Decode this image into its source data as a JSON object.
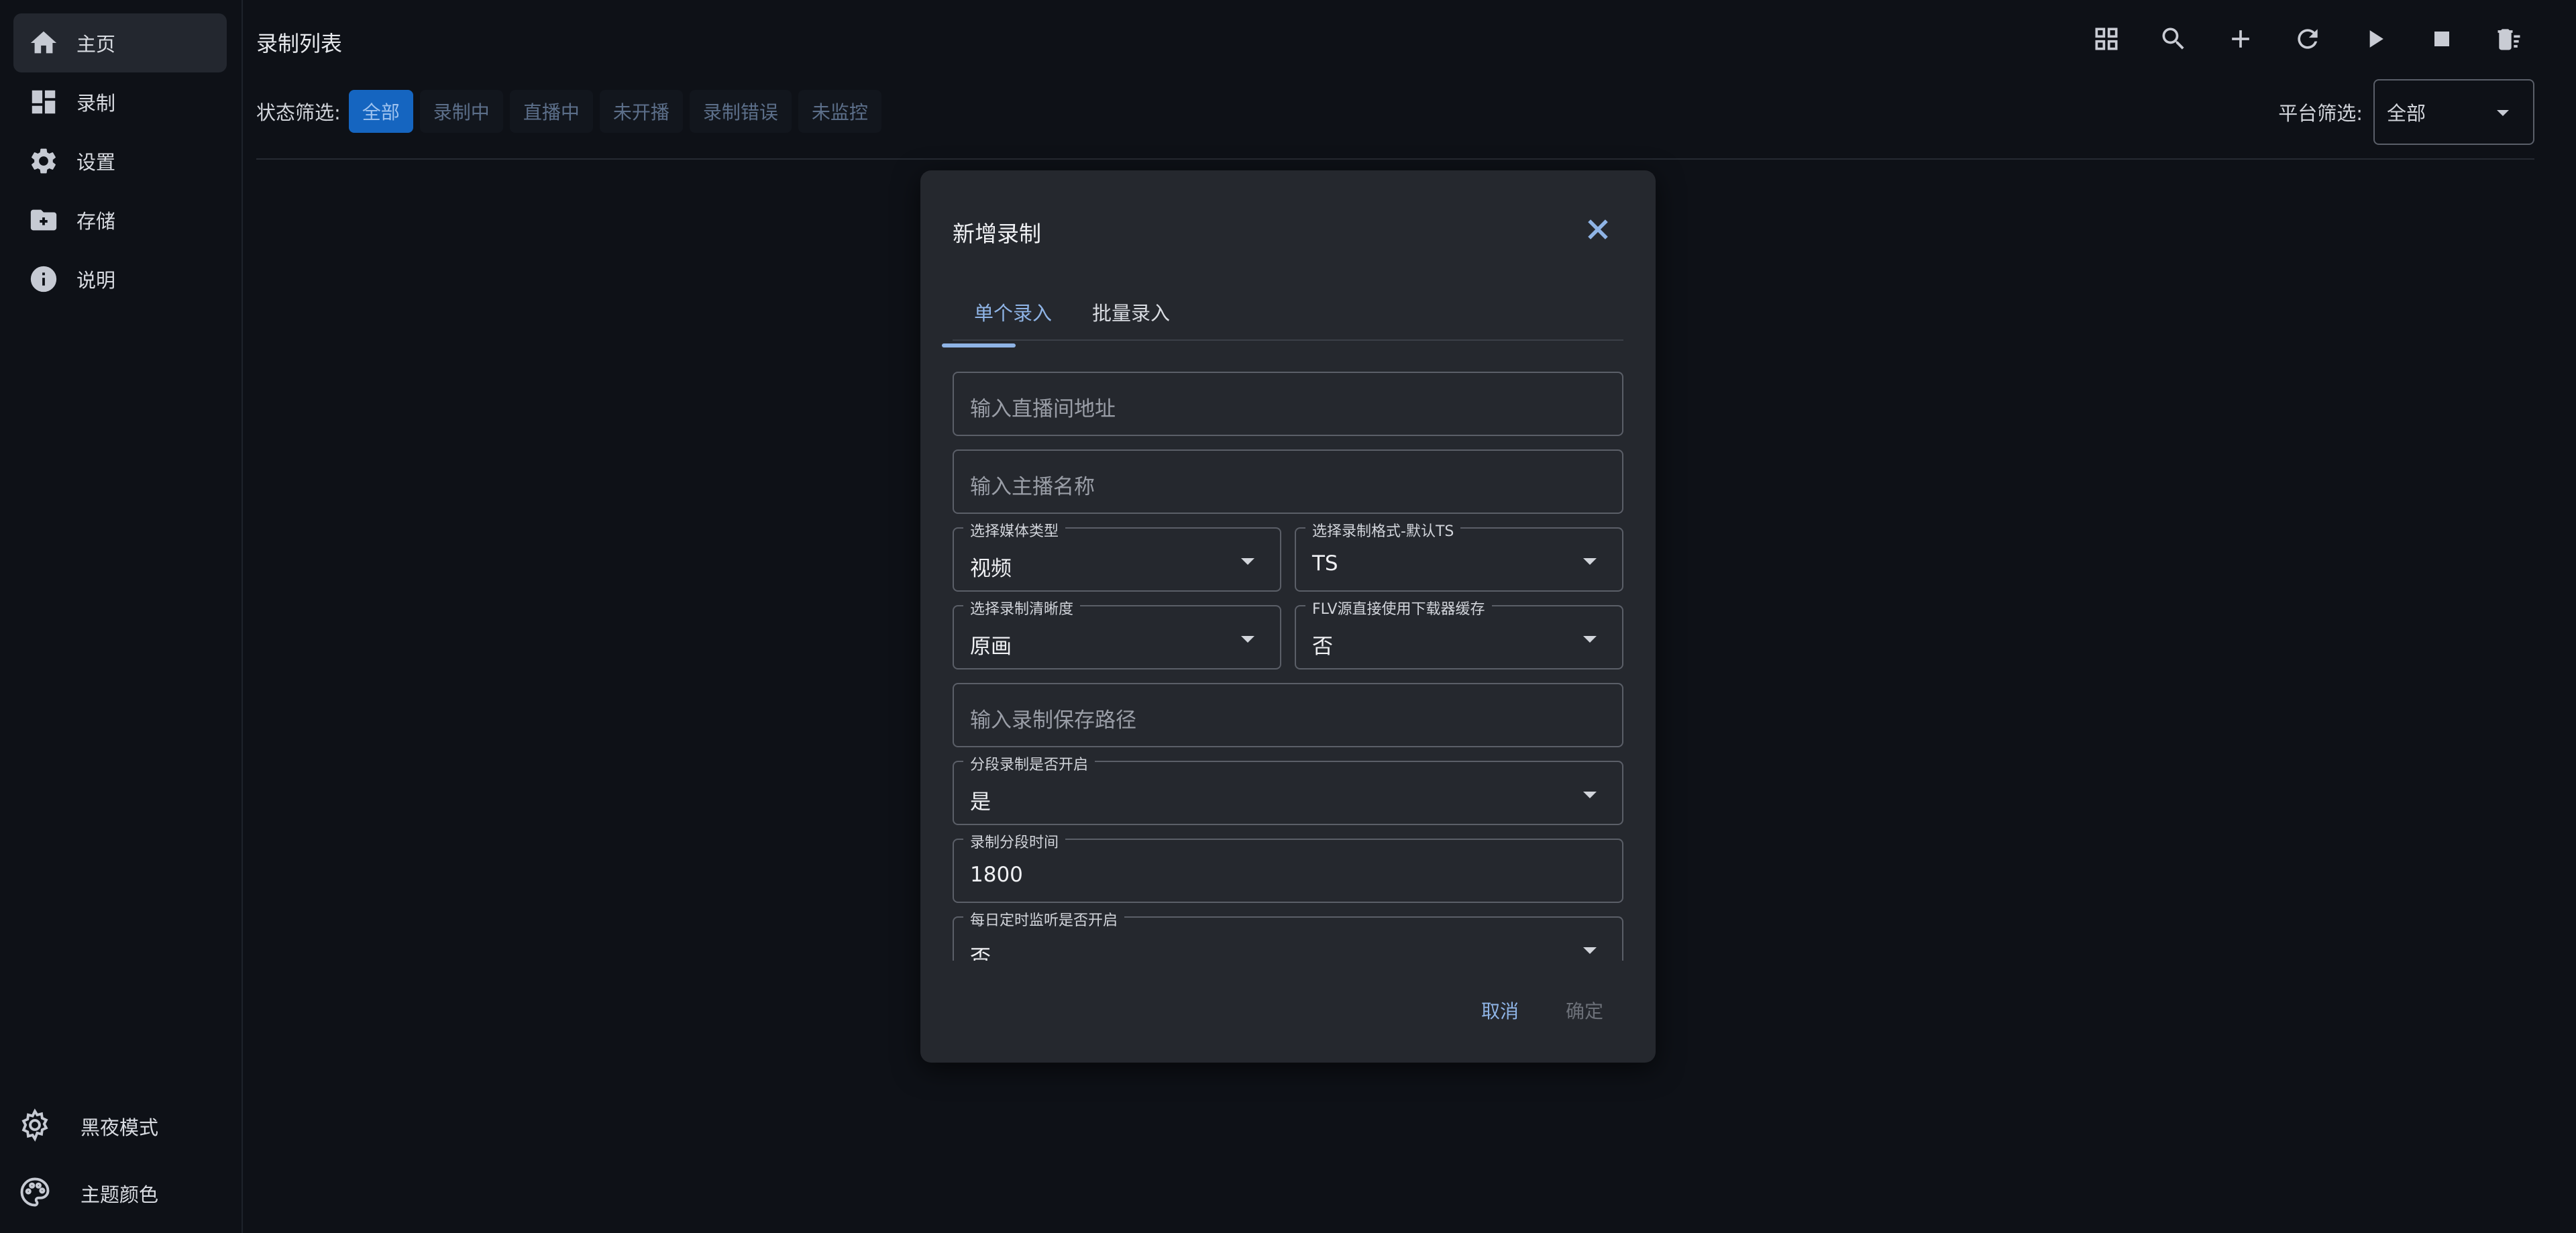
{
  "sidebar": {
    "items": [
      {
        "label": "主页",
        "icon": "home-icon"
      },
      {
        "label": "录制",
        "icon": "dashboard-icon"
      },
      {
        "label": "设置",
        "icon": "gear-icon"
      },
      {
        "label": "存储",
        "icon": "folder-icon"
      },
      {
        "label": "说明",
        "icon": "info-icon"
      }
    ],
    "bottom": [
      {
        "label": "黑夜模式",
        "icon": "dark-mode-icon"
      },
      {
        "label": "主题颜色",
        "icon": "palette-icon"
      }
    ]
  },
  "header": {
    "title": "录制列表",
    "toolbar": [
      "grid-view-icon",
      "search-icon",
      "add-icon",
      "refresh-icon",
      "play-icon",
      "stop-icon",
      "delete-icon"
    ]
  },
  "filters": {
    "status_label": "状态筛选:",
    "chips": [
      "全部",
      "录制中",
      "直播中",
      "未开播",
      "录制错误",
      "未监控"
    ],
    "active_chip": "全部",
    "platform_label": "平台筛选:",
    "platform_value": "全部"
  },
  "modal": {
    "title": "新增录制",
    "tabs": [
      "单个录入",
      "批量录入"
    ],
    "active_tab": "单个录入",
    "fields": {
      "room_url_placeholder": "输入直播间地址",
      "streamer_name_placeholder": "输入主播名称",
      "media_type": {
        "label": "选择媒体类型",
        "value": "视频"
      },
      "record_format": {
        "label": "选择录制格式-默认TS",
        "value": "TS"
      },
      "quality": {
        "label": "选择录制清晰度",
        "value": "原画"
      },
      "flv_cache": {
        "label": "FLV源直接使用下载器缓存",
        "value": "否"
      },
      "save_path_placeholder": "输入录制保存路径",
      "segment_enabled": {
        "label": "分段录制是否开启",
        "value": "是"
      },
      "segment_time": {
        "label": "录制分段时间",
        "value": "1800"
      },
      "daily_monitor": {
        "label": "每日定时监听是否开启",
        "value": "否"
      }
    },
    "cancel_label": "取消",
    "confirm_label": "确定"
  },
  "colors": {
    "background": "#0e1117",
    "modal": "#25282e",
    "accent": "#8fb4e6",
    "chip_active": "#1565c0"
  }
}
